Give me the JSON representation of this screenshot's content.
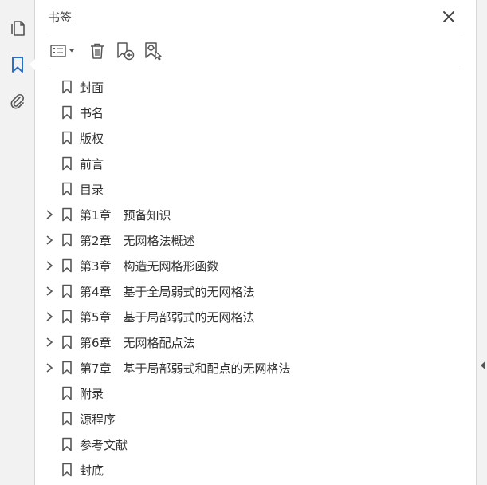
{
  "panel": {
    "title": "书签",
    "close_icon": "close-icon"
  },
  "rail": {
    "items": [
      {
        "name": "page-thumbnails",
        "icon": "page-thumbnails-icon"
      },
      {
        "name": "bookmarks",
        "icon": "bookmark-icon",
        "active": true
      },
      {
        "name": "attachments",
        "icon": "paperclip-icon"
      }
    ]
  },
  "toolbar": {
    "items": [
      {
        "name": "options-menu",
        "icon": "list-options-icon"
      },
      {
        "name": "delete-bookmark",
        "icon": "trash-icon"
      },
      {
        "name": "new-bookmark",
        "icon": "new-bookmark-icon"
      },
      {
        "name": "find-current-bookmark",
        "icon": "find-bookmark-icon"
      }
    ]
  },
  "bookmarks": [
    {
      "label": "封面",
      "expandable": false
    },
    {
      "label": "书名",
      "expandable": false
    },
    {
      "label": "版权",
      "expandable": false
    },
    {
      "label": "前言",
      "expandable": false
    },
    {
      "label": "目录",
      "expandable": false
    },
    {
      "label": "第1章　预备知识",
      "expandable": true
    },
    {
      "label": "第2章　无网格法概述",
      "expandable": true
    },
    {
      "label": "第3章　构造无网格形函数",
      "expandable": true
    },
    {
      "label": "第4章　基于全局弱式的无网格法",
      "expandable": true
    },
    {
      "label": "第5章　基于局部弱式的无网格法",
      "expandable": true
    },
    {
      "label": "第6章　无网格配点法",
      "expandable": true
    },
    {
      "label": "第7章　基于局部弱式和配点的无网格法",
      "expandable": true
    },
    {
      "label": "附录",
      "expandable": false
    },
    {
      "label": "源程序",
      "expandable": false
    },
    {
      "label": "参考文献",
      "expandable": false
    },
    {
      "label": "封底",
      "expandable": false
    }
  ],
  "colors": {
    "accent": "#2d6fc4",
    "icon_gray": "#555555"
  }
}
